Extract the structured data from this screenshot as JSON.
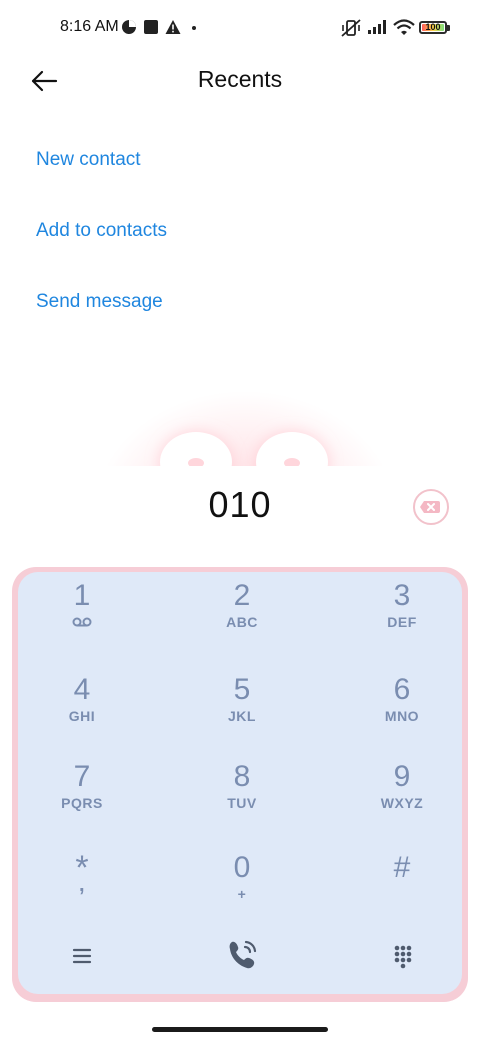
{
  "status_bar": {
    "time": "8:16 AM",
    "battery": "100"
  },
  "header": {
    "title": "Recents"
  },
  "actions": [
    {
      "label": "New contact"
    },
    {
      "label": "Add to contacts"
    },
    {
      "label": "Send message"
    }
  ],
  "dialer": {
    "number": "010",
    "keys": [
      {
        "digit": "1",
        "letters": ""
      },
      {
        "digit": "2",
        "letters": "ABC"
      },
      {
        "digit": "3",
        "letters": "DEF"
      },
      {
        "digit": "4",
        "letters": "GHI"
      },
      {
        "digit": "5",
        "letters": "JKL"
      },
      {
        "digit": "6",
        "letters": "MNO"
      },
      {
        "digit": "7",
        "letters": "PQRS"
      },
      {
        "digit": "8",
        "letters": "TUV"
      },
      {
        "digit": "9",
        "letters": "WXYZ"
      },
      {
        "digit": "*",
        "letters": ","
      },
      {
        "digit": "0",
        "letters": "+"
      },
      {
        "digit": "#",
        "letters": ""
      }
    ]
  },
  "colors": {
    "accent": "#1f86df",
    "keypad_bg": "#dfe9f8",
    "keypad_border": "#f6cdd6",
    "key_text": "#7a8db0"
  },
  "icons": [
    "back-arrow-icon",
    "voicemail-icon",
    "backspace-icon",
    "menu-icon",
    "call-icon",
    "dialpad-icon"
  ]
}
